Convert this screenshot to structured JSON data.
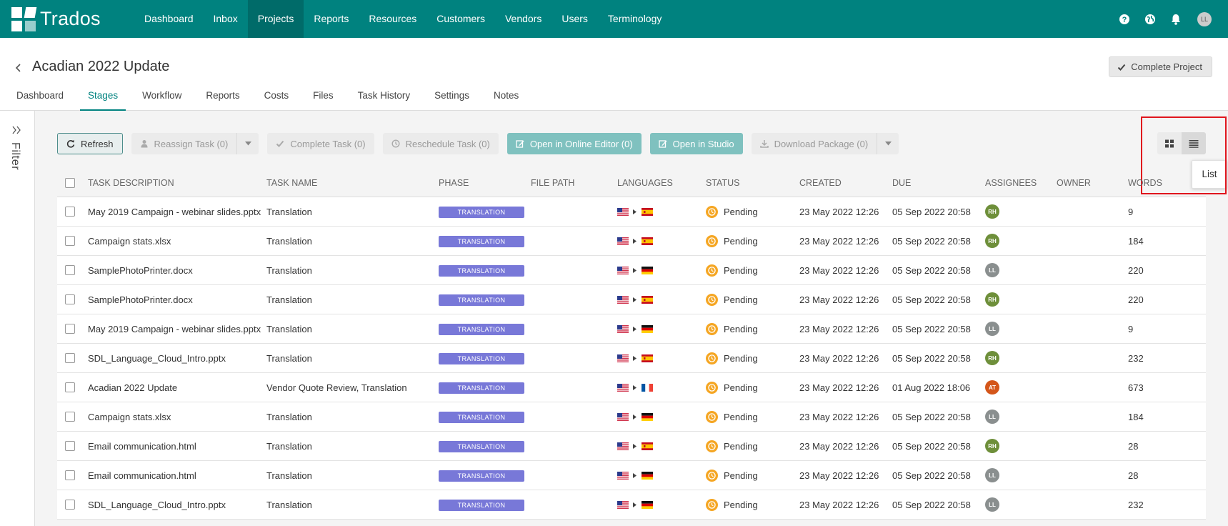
{
  "app": {
    "name": "Trados"
  },
  "nav": {
    "items": [
      "Dashboard",
      "Inbox",
      "Projects",
      "Reports",
      "Resources",
      "Customers",
      "Vendors",
      "Users",
      "Terminology"
    ],
    "active_index": 2
  },
  "topbar": {
    "user_initials": "LL"
  },
  "project": {
    "title": "Acadian 2022 Update",
    "complete_label": "Complete Project",
    "tabs": [
      "Dashboard",
      "Stages",
      "Workflow",
      "Reports",
      "Costs",
      "Files",
      "Task History",
      "Settings",
      "Notes"
    ],
    "active_tab_index": 1
  },
  "filter": {
    "label": "Filter"
  },
  "toolbar": {
    "refresh": "Refresh",
    "reassign": "Reassign Task (0)",
    "complete": "Complete Task (0)",
    "reschedule": "Reschedule Task (0)",
    "open_online": "Open in Online Editor (0)",
    "open_studio": "Open in Studio",
    "download": "Download Package (0)"
  },
  "view": {
    "tooltip": "List",
    "active": "list"
  },
  "table": {
    "headers": [
      "TASK DESCRIPTION",
      "TASK NAME",
      "PHASE",
      "FILE PATH",
      "LANGUAGES",
      "STATUS",
      "CREATED",
      "DUE",
      "ASSIGNEES",
      "OWNER",
      "WORDS"
    ],
    "rows": [
      {
        "desc": "May 2019 Campaign - webinar slides.pptx",
        "name": "Translation",
        "phase": "TRANSLATION",
        "path": "",
        "src": "us",
        "tgt": "es",
        "status": "Pending",
        "created": "23 May 2022 12:26",
        "due": "05 Sep 2022 20:58",
        "assignee": "RH",
        "owner": "",
        "words": "9"
      },
      {
        "desc": "Campaign stats.xlsx",
        "name": "Translation",
        "phase": "TRANSLATION",
        "path": "",
        "src": "us",
        "tgt": "es",
        "status": "Pending",
        "created": "23 May 2022 12:26",
        "due": "05 Sep 2022 20:58",
        "assignee": "RH",
        "owner": "",
        "words": "184"
      },
      {
        "desc": "SamplePhotoPrinter.docx",
        "name": "Translation",
        "phase": "TRANSLATION",
        "path": "",
        "src": "us",
        "tgt": "de",
        "status": "Pending",
        "created": "23 May 2022 12:26",
        "due": "05 Sep 2022 20:58",
        "assignee": "LL",
        "owner": "",
        "words": "220"
      },
      {
        "desc": "SamplePhotoPrinter.docx",
        "name": "Translation",
        "phase": "TRANSLATION",
        "path": "",
        "src": "us",
        "tgt": "es",
        "status": "Pending",
        "created": "23 May 2022 12:26",
        "due": "05 Sep 2022 20:58",
        "assignee": "RH",
        "owner": "",
        "words": "220"
      },
      {
        "desc": "May 2019 Campaign - webinar slides.pptx",
        "name": "Translation",
        "phase": "TRANSLATION",
        "path": "",
        "src": "us",
        "tgt": "de",
        "status": "Pending",
        "created": "23 May 2022 12:26",
        "due": "05 Sep 2022 20:58",
        "assignee": "LL",
        "owner": "",
        "words": "9"
      },
      {
        "desc": "SDL_Language_Cloud_Intro.pptx",
        "name": "Translation",
        "phase": "TRANSLATION",
        "path": "",
        "src": "us",
        "tgt": "es",
        "status": "Pending",
        "created": "23 May 2022 12:26",
        "due": "05 Sep 2022 20:58",
        "assignee": "RH",
        "owner": "",
        "words": "232"
      },
      {
        "desc": "Acadian 2022 Update",
        "name": "Vendor Quote Review, Translation",
        "phase": "TRANSLATION",
        "path": "",
        "src": "us",
        "tgt": "fr",
        "status": "Pending",
        "created": "23 May 2022 12:26",
        "due": "01 Aug 2022 18:06",
        "assignee": "AT",
        "owner": "",
        "words": "673"
      },
      {
        "desc": "Campaign stats.xlsx",
        "name": "Translation",
        "phase": "TRANSLATION",
        "path": "",
        "src": "us",
        "tgt": "de",
        "status": "Pending",
        "created": "23 May 2022 12:26",
        "due": "05 Sep 2022 20:58",
        "assignee": "LL",
        "owner": "",
        "words": "184"
      },
      {
        "desc": "Email communication.html",
        "name": "Translation",
        "phase": "TRANSLATION",
        "path": "",
        "src": "us",
        "tgt": "es",
        "status": "Pending",
        "created": "23 May 2022 12:26",
        "due": "05 Sep 2022 20:58",
        "assignee": "RH",
        "owner": "",
        "words": "28"
      },
      {
        "desc": "Email communication.html",
        "name": "Translation",
        "phase": "TRANSLATION",
        "path": "",
        "src": "us",
        "tgt": "de",
        "status": "Pending",
        "created": "23 May 2022 12:26",
        "due": "05 Sep 2022 20:58",
        "assignee": "LL",
        "owner": "",
        "words": "28"
      },
      {
        "desc": "SDL_Language_Cloud_Intro.pptx",
        "name": "Translation",
        "phase": "TRANSLATION",
        "path": "",
        "src": "us",
        "tgt": "de",
        "status": "Pending",
        "created": "23 May 2022 12:26",
        "due": "05 Sep 2022 20:58",
        "assignee": "LL",
        "owner": "",
        "words": "232"
      }
    ]
  },
  "colors": {
    "brand": "#00827f",
    "phase_badge": "#7878d8",
    "pending": "#f5a623",
    "avatar_RH": "#6e8f3a",
    "avatar_LL": "#8a8f8f",
    "avatar_AT": "#d4561a",
    "highlight": "#e0151d"
  }
}
